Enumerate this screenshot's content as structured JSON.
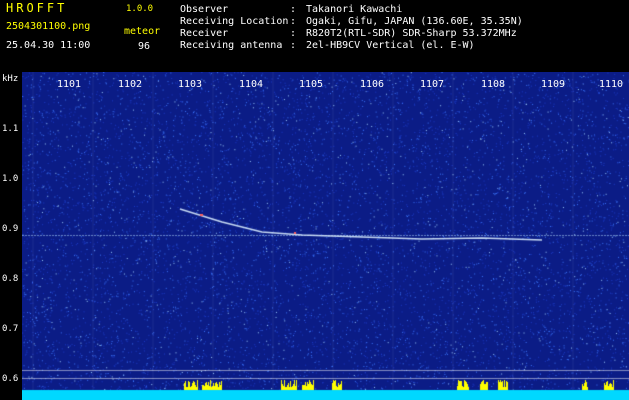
{
  "app": {
    "title": "HROFFT",
    "version": "1.0.0"
  },
  "capture": {
    "filename": "2504301100.png",
    "datetime": "25.04.30 11:00",
    "mode": "meteor",
    "count": "96"
  },
  "station": [
    {
      "label": "Observer",
      "value": "Takanori Kawachi"
    },
    {
      "label": "Receiving Location",
      "value": "Ogaki, Gifu, JAPAN (136.60E, 35.35N)"
    },
    {
      "label": "Receiver",
      "value": "R820T2(RTL-SDR) SDR-Sharp 53.372MHz"
    },
    {
      "label": "Receiving antenna",
      "value": "2el-HB9CV Vertical (el. E-W)"
    }
  ],
  "axes": {
    "y_unit": "kHz",
    "x_ticks": [
      "1101",
      "1102",
      "1103",
      "1104",
      "1105",
      "1106",
      "1107",
      "1108",
      "1109",
      "1110"
    ],
    "y_ticks": [
      "1.1",
      "1.0",
      "0.9",
      "0.8",
      "0.7",
      "0.6"
    ]
  },
  "colors": {
    "background": "#0b1c86",
    "noise": "#2f6dff",
    "signal": "#ffffff",
    "header_accent": "#ffff00",
    "baseline": "#00d8ff"
  }
}
